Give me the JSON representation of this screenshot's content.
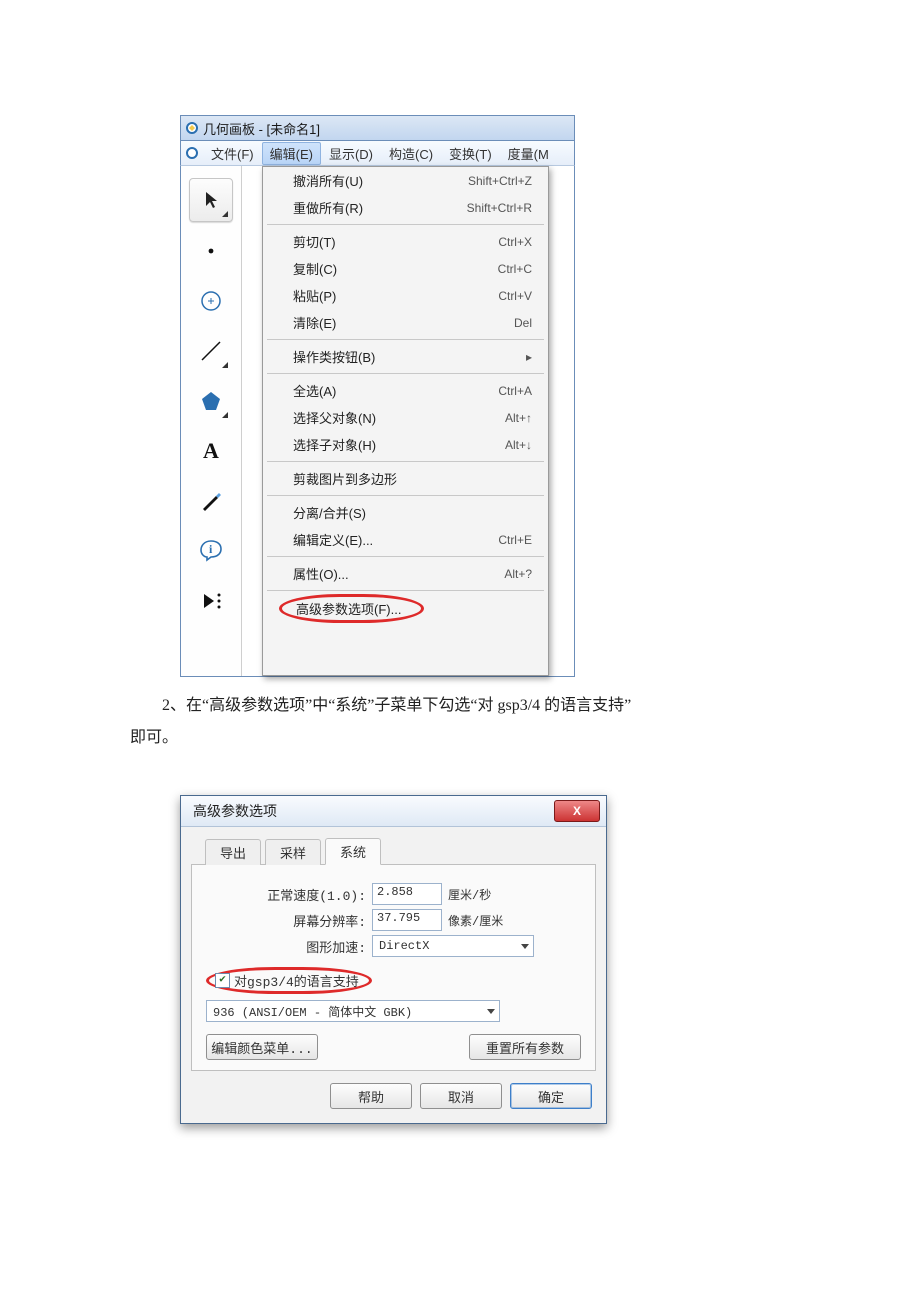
{
  "app": {
    "title": "几何画板 - [未命名1]"
  },
  "menubar": {
    "items": [
      "文件(F)",
      "编辑(E)",
      "显示(D)",
      "构造(C)",
      "变换(T)",
      "度量(M"
    ],
    "active_index": 1
  },
  "dropdown": {
    "groups": [
      [
        {
          "label": "撤消所有(U)",
          "shortcut": "Shift+Ctrl+Z"
        },
        {
          "label": "重做所有(R)",
          "shortcut": "Shift+Ctrl+R"
        }
      ],
      [
        {
          "label": "剪切(T)",
          "shortcut": "Ctrl+X"
        },
        {
          "label": "复制(C)",
          "shortcut": "Ctrl+C"
        },
        {
          "label": "粘贴(P)",
          "shortcut": "Ctrl+V"
        },
        {
          "label": "清除(E)",
          "shortcut": "Del"
        }
      ],
      [
        {
          "label": "操作类按钮(B)",
          "shortcut": "▸"
        }
      ],
      [
        {
          "label": "全选(A)",
          "shortcut": "Ctrl+A"
        },
        {
          "label": "选择父对象(N)",
          "shortcut": "Alt+↑"
        },
        {
          "label": "选择子对象(H)",
          "shortcut": "Alt+↓"
        }
      ],
      [
        {
          "label": "剪裁图片到多边形",
          "shortcut": ""
        }
      ],
      [
        {
          "label": "分离/合并(S)",
          "shortcut": ""
        },
        {
          "label": "编辑定义(E)...",
          "shortcut": "Ctrl+E"
        }
      ],
      [
        {
          "label": "属性(O)...",
          "shortcut": "Alt+?"
        }
      ]
    ],
    "highlighted": "高级参数选项(F)..."
  },
  "paragraph": {
    "text_line1": "2、在“高级参数选项”中“系统”子菜单下勾选“对 gsp3/4 的语言支持”",
    "text_line2": "即可。"
  },
  "dialog": {
    "title": "高级参数选项",
    "close_label": "X",
    "tabs": [
      "导出",
      "采样",
      "系统"
    ],
    "active_tab": 2,
    "fields": {
      "speed_label": "正常速度(1.0):",
      "speed_value": "2.858",
      "speed_unit": "厘米/秒",
      "res_label": "屏幕分辨率:",
      "res_value": "37.795",
      "res_unit": "像素/厘米",
      "accel_label": "图形加速:",
      "accel_value": "DirectX"
    },
    "checkbox": {
      "checked": true,
      "label": "对gsp3/4的语言支持"
    },
    "encoding_value": "936   (ANSI/OEM - 简体中文 GBK)",
    "buttons": {
      "edit_colors": "编辑颜色菜单...",
      "reset": "重置所有参数",
      "help": "帮助",
      "cancel": "取消",
      "ok": "确定"
    }
  }
}
